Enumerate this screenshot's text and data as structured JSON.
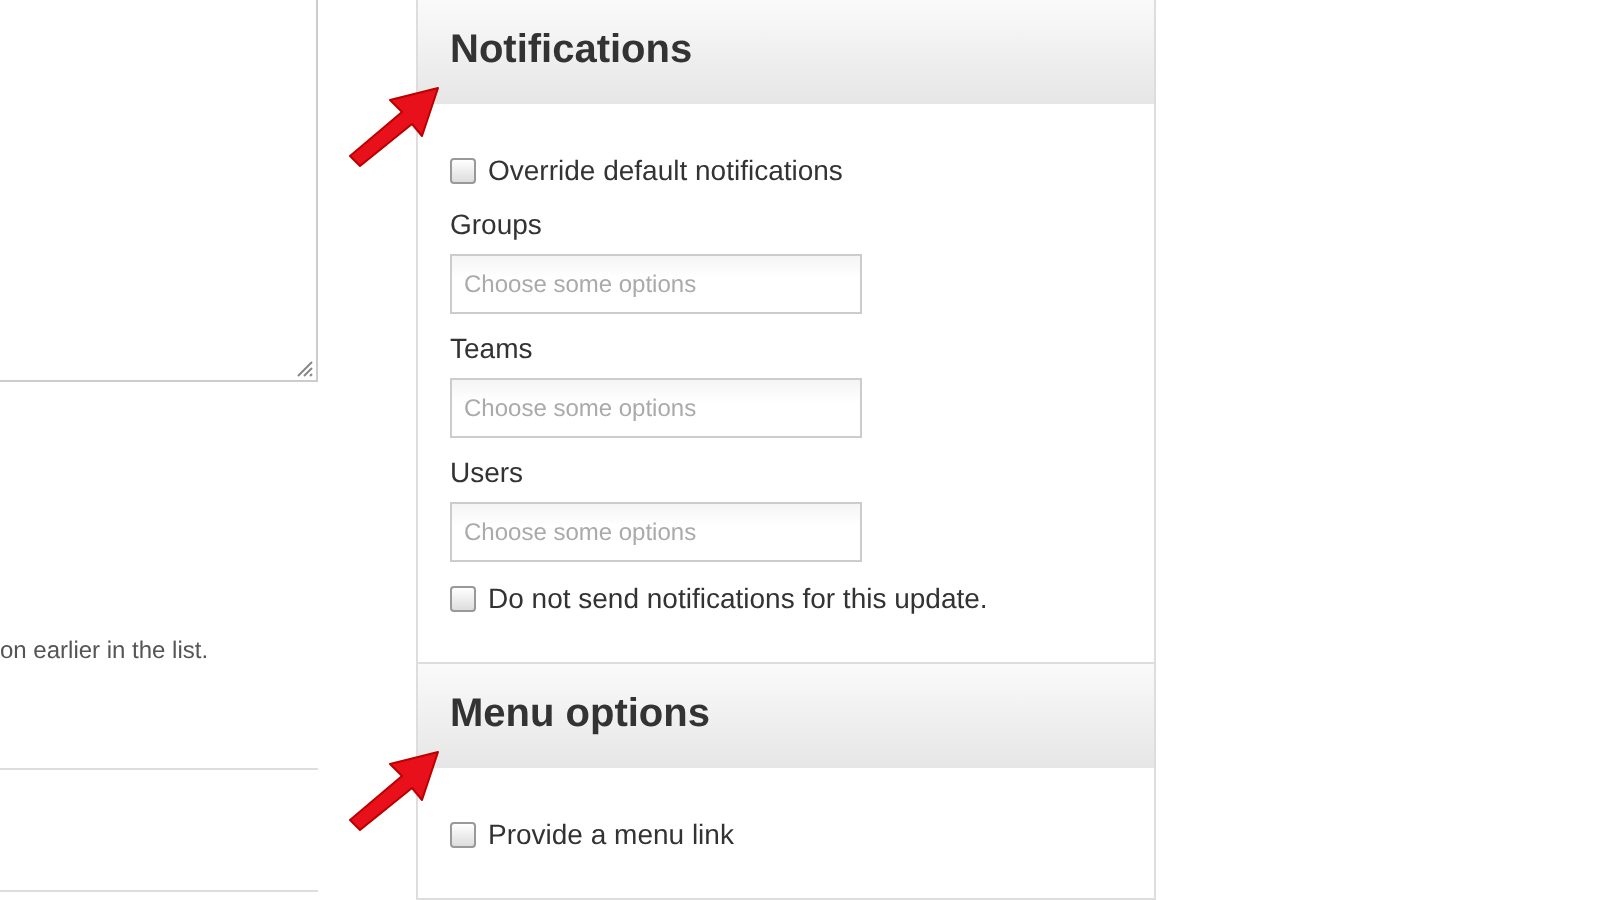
{
  "left_column": {
    "help_text": "on earlier in the list."
  },
  "sections": [
    {
      "title": "Notifications",
      "arrow": true,
      "items": [
        {
          "kind": "checkbox",
          "label": "Override default notifications",
          "checked": false
        },
        {
          "kind": "select",
          "label": "Groups",
          "placeholder": "Choose some options"
        },
        {
          "kind": "select",
          "label": "Teams",
          "placeholder": "Choose some options"
        },
        {
          "kind": "select",
          "label": "Users",
          "placeholder": "Choose some options"
        },
        {
          "kind": "checkbox",
          "label": "Do not send notifications for this update.",
          "checked": false
        }
      ]
    },
    {
      "title": "Menu options",
      "arrow": true,
      "items": [
        {
          "kind": "checkbox",
          "label": "Provide a menu link",
          "checked": false
        }
      ]
    }
  ]
}
